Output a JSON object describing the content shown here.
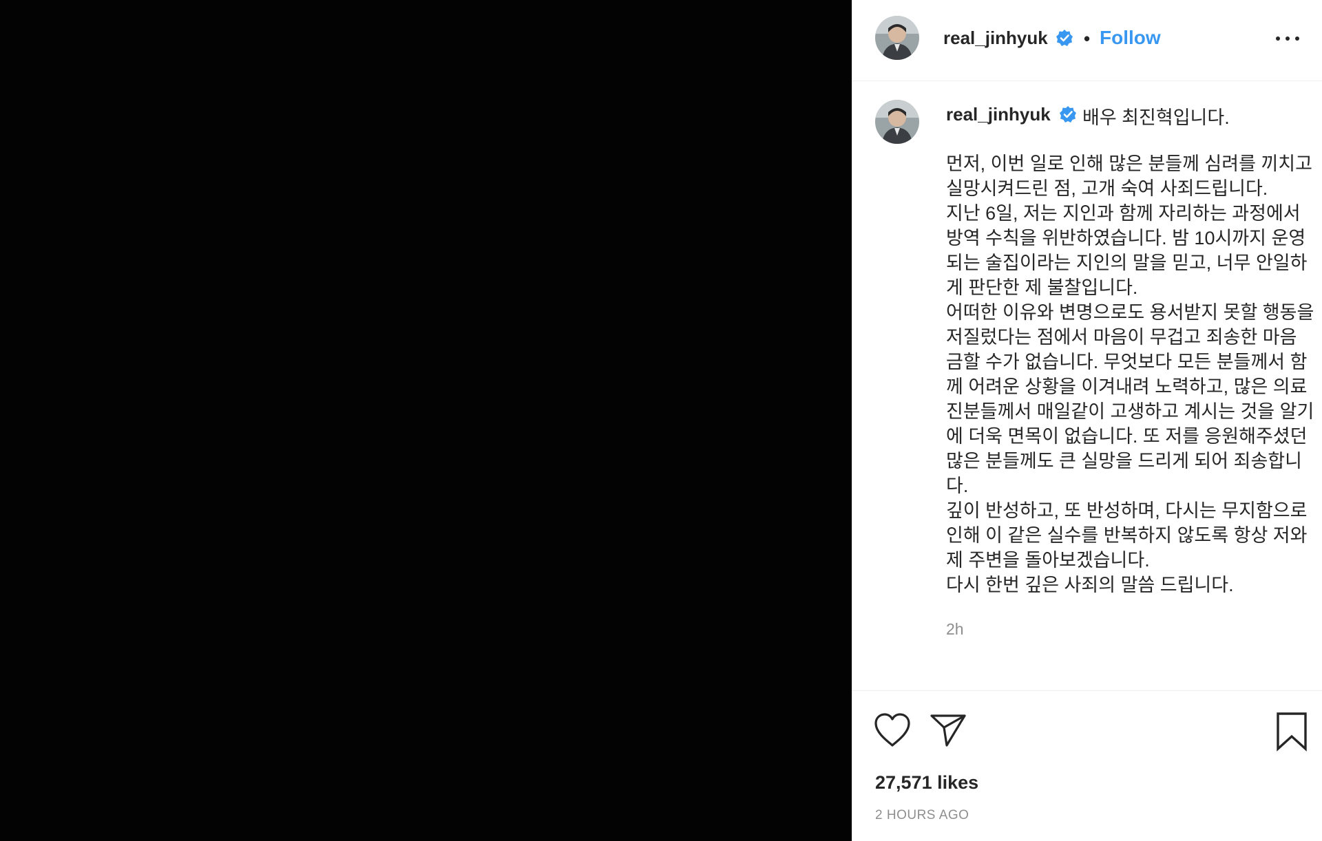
{
  "post": {
    "media": {
      "description_icon": "black-image"
    },
    "header": {
      "username": "real_jinhyuk",
      "separator": "•",
      "follow_label": "Follow",
      "more_icon": "more-horizontal-icon"
    },
    "caption": {
      "username": "real_jinhyuk",
      "first_line": "배우 최진혁입니다.",
      "body": "먼저, 이번 일로 인해 많은 분들께 심려를 끼치고 실망시켜드린 점, 고개 숙여 사죄드립니다.\n지난 6일, 저는 지인과 함께 자리하는 과정에서 방역 수칙을 위반하였습니다. 밤 10시까지 운영되는 술집이라는 지인의 말을 믿고, 너무 안일하게 판단한 제 불찰입니다.\n어떠한 이유와 변명으로도 용서받지 못할 행동을 저질렀다는 점에서 마음이 무겁고 죄송한 마음 금할 수가 없습니다. 무엇보다 모든 분들께서 함께 어려운 상황을 이겨내려 노력하고, 많은 의료진분들께서 매일같이 고생하고 계시는 것을 알기에 더욱 면목이 없습니다. 또 저를 응원해주셨던 많은 분들께도 큰 실망을 드리게 되어 죄송합니다.\n깊이 반성하고, 또 반성하며, 다시는 무지함으로 인해 이 같은 실수를 반복하지 않도록 항상 저와 제 주변을 돌아보겠습니다.\n다시 한번 깊은 사죄의 말씀 드립니다.",
      "time": "2h"
    },
    "actions": {
      "like_icon": "heart-icon",
      "share_icon": "paper-plane-icon",
      "save_icon": "bookmark-icon"
    },
    "likes_text": "27,571 likes",
    "posted_text": "2 HOURS AGO"
  },
  "colors": {
    "media_bg": "#030303",
    "accent": "#3897f0",
    "text": "#262626",
    "muted": "#8e8e8e",
    "border": "#efefef"
  }
}
